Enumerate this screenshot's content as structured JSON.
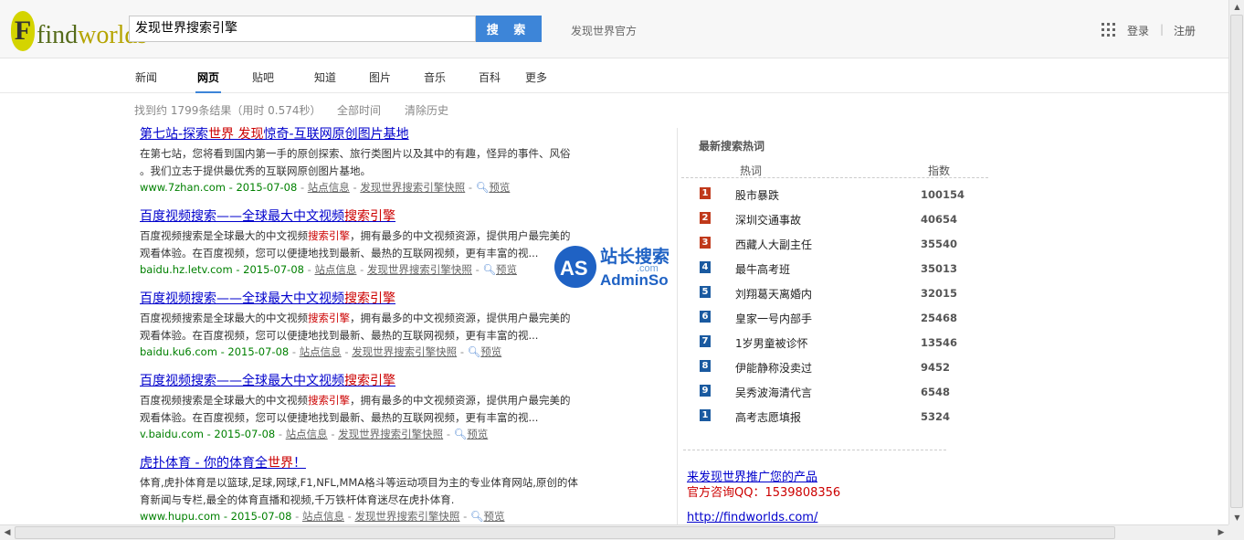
{
  "header": {
    "logo_f": "F",
    "logo_find": "find",
    "logo_worlds": "worlds",
    "search_value": "发现世界搜索引擎",
    "search_button": "搜 索",
    "official_link": "发现世界官方",
    "login": "登录",
    "separator": "|",
    "register": "注册"
  },
  "tabs": [
    "新闻",
    "网页",
    "贴吧",
    "知道",
    "图片",
    "音乐",
    "百科",
    "更多"
  ],
  "active_tab": "网页",
  "toolbar": {
    "stats": "找到约 1799条结果（用时 0.574秒）",
    "time_filter": "全部时间",
    "clear_history": "清除历史"
  },
  "results": [
    {
      "title_parts": [
        "第七站-探索",
        "世界 发现",
        "惊奇-互联网原创图片基地"
      ],
      "snippet_lines": [
        [
          "在第七站，您将看到国内第一手的原创探索、旅行类图片以及其中的有趣，怪异的事件、风俗"
        ],
        [
          "。我们立志于提供最优秀的互联网原创图片基地。"
        ]
      ],
      "url": "www.7zhan.com - 2015-07-08",
      "site_info": "站点信息",
      "snapshot": "发现世界搜索引擎快照",
      "preview": "预览"
    },
    {
      "title_parts": [
        "百度视频搜索——全球最大中文视频",
        "搜索引擎",
        ""
      ],
      "snippet_lines": [
        [
          "百度视频搜索是全球最大的中文视频",
          "搜索引擎",
          "，拥有最多的中文视频资源，提供用户最完美的"
        ],
        [
          "观看体验。在百度视频，您可以便捷地找到最新、最热的互联网视频，更有丰富的视..."
        ]
      ],
      "url": "baidu.hz.letv.com - 2015-07-08",
      "site_info": "站点信息",
      "snapshot": "发现世界搜索引擎快照",
      "preview": "预览"
    },
    {
      "title_parts": [
        "百度视频搜索——全球最大中文视频",
        "搜索引擎",
        ""
      ],
      "snippet_lines": [
        [
          "百度视频搜索是全球最大的中文视频",
          "搜索引擎",
          "，拥有最多的中文视频资源，提供用户最完美的"
        ],
        [
          "观看体验。在百度视频，您可以便捷地找到最新、最热的互联网视频，更有丰富的视..."
        ]
      ],
      "url": "baidu.ku6.com - 2015-07-08",
      "site_info": "站点信息",
      "snapshot": "发现世界搜索引擎快照",
      "preview": "预览"
    },
    {
      "title_parts": [
        "百度视频搜索——全球最大中文视频",
        "搜索引擎",
        ""
      ],
      "snippet_lines": [
        [
          "百度视频搜索是全球最大的中文视频",
          "搜索引擎",
          "，拥有最多的中文视频资源，提供用户最完美的"
        ],
        [
          "观看体验。在百度视频，您可以便捷地找到最新、最热的互联网视频，更有丰富的视..."
        ]
      ],
      "url": "v.baidu.com - 2015-07-08",
      "site_info": "站点信息",
      "snapshot": "发现世界搜索引擎快照",
      "preview": "预览"
    },
    {
      "title_parts": [
        "虎扑体育 - 你的体育全",
        "世界",
        "！"
      ],
      "snippet_lines": [
        [
          "体育,虎扑体育是以篮球,足球,网球,F1,NFL,MMA格斗等运动项目为主的专业体育网站,原创的体"
        ],
        [
          "育新闻与专栏,最全的体育直播和视频,千万铁杆体育迷尽在虎扑体育."
        ]
      ],
      "url": "www.hupu.com - 2015-07-08",
      "site_info": "站点信息",
      "snapshot": "发现世界搜索引擎快照",
      "preview": "预览"
    }
  ],
  "hot": {
    "title": "最新搜索热词",
    "col_keyword": "热词",
    "col_index": "指数",
    "items": [
      {
        "rank": "1",
        "keyword": "股市暴跌",
        "index": "100154"
      },
      {
        "rank": "2",
        "keyword": "深圳交通事故",
        "index": "40654"
      },
      {
        "rank": "3",
        "keyword": "西藏人大副主任",
        "index": "35540"
      },
      {
        "rank": "4",
        "keyword": "最牛高考班",
        "index": "35013"
      },
      {
        "rank": "5",
        "keyword": "刘翔葛天离婚内",
        "index": "32015"
      },
      {
        "rank": "6",
        "keyword": "皇家一号内部手",
        "index": "25468"
      },
      {
        "rank": "7",
        "keyword": "1岁男童被诊怀",
        "index": "13546"
      },
      {
        "rank": "8",
        "keyword": "伊能静称没卖过",
        "index": "9452"
      },
      {
        "rank": "9",
        "keyword": "吴秀波海清代言",
        "index": "6548"
      },
      {
        "rank": "1",
        "keyword": "高考志愿填报",
        "index": "5324"
      }
    ]
  },
  "promo": {
    "title": "来发现世界推广您的产品",
    "qq": "官方咨询QQ：1539808356",
    "url": "http://findworlds.com/"
  },
  "watermark": {
    "as": "AS",
    "cn": "站长搜索",
    "com": ".com",
    "admin": "AdminSo"
  },
  "colors": {
    "accent": "#3d85d8",
    "link": "#0000cc",
    "highlight": "#cc0000",
    "url_green": "#008000",
    "rank_top": "#c0391b",
    "rank_normal": "#1a5aa0"
  }
}
